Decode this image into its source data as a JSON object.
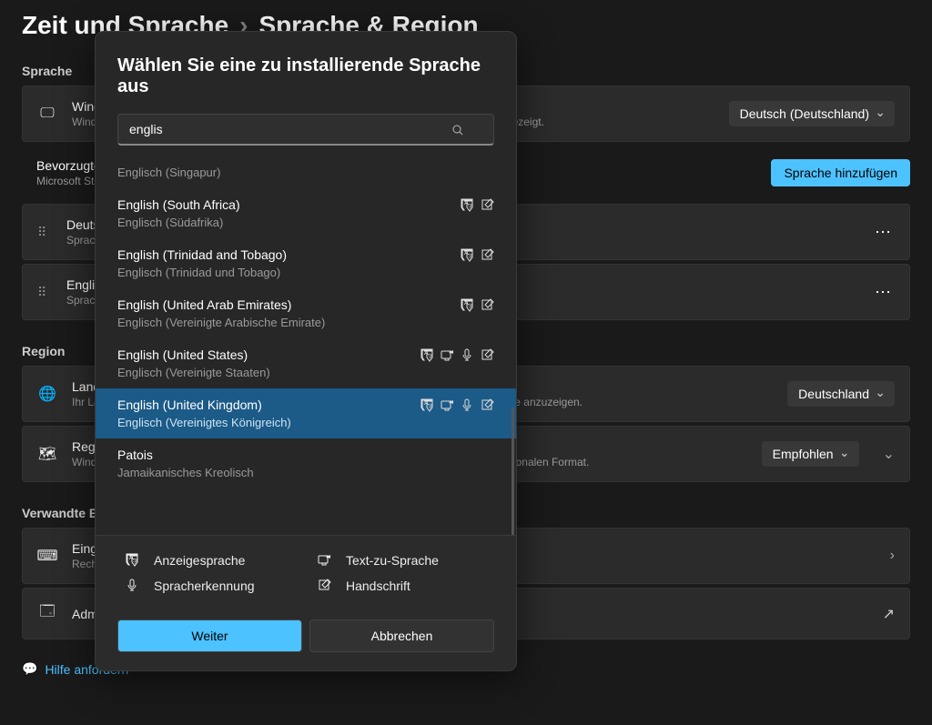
{
  "breadcrumb": {
    "crumb1": "Zeit und Sprache",
    "crumb2": "Sprache & Region"
  },
  "sections": {
    "sprache": "Sprache",
    "region": "Region",
    "verwandte": "Verwandte Einstellungen"
  },
  "cards": {
    "display": {
      "title": "Windows-Anzeigesprache",
      "sub": "Windows-Features wie Einstellungen und der Datei-Explorer werden in dieser Sprache angezeigt.",
      "value": "Deutsch (Deutschland)"
    },
    "preferred": {
      "title": "Bevorzugte Sprachen",
      "sub": "Microsoft Store-Apps werden in der ersten unterstützten Sprache aus dieser Liste angezeigt",
      "button": "Sprache hinzufügen"
    },
    "lang1": {
      "title": "Deutsch (Deutschland)",
      "sub": "Sprachpaket, Text-zu-Sprache, Spracherkennung, Handschrift"
    },
    "lang2": {
      "title": "English (United States)",
      "sub": "Sprachpaket, Text-zu-Sprache, Spracherkennung, Handschrift"
    },
    "country": {
      "title": "Land oder Region",
      "sub": "Ihr Land oder Ihre Region kann von Windows und Apps verwendet werden, um lokale Inhalte anzuzeigen.",
      "value": "Deutschland"
    },
    "format": {
      "title": "Regionales Format",
      "sub": "Windows und einige Apps formatieren Datums- und Uhrzeitangaben basierend auf dem regionalen Format.",
      "value": "Empfohlen"
    },
    "typing": {
      "title": "Eingabe",
      "sub": "Rechtschreibprüfung, Autokorrektur und Textvorschläge"
    },
    "admin": {
      "title": "Administrative Spracheinstellungen"
    }
  },
  "help": "Hilfe anfordern",
  "modal": {
    "title": "Wählen Sie eine zu installierende Sprache aus",
    "search_value": "englis",
    "items": [
      {
        "name": "",
        "sub": "Englisch (Singapur)",
        "icons": [],
        "headerOnly": true
      },
      {
        "name": "English (South Africa)",
        "sub": "Englisch (Südafrika)",
        "icons": [
          "display",
          "hand"
        ]
      },
      {
        "name": "English (Trinidad and Tobago)",
        "sub": "Englisch (Trinidad und Tobago)",
        "icons": [
          "display",
          "hand"
        ]
      },
      {
        "name": "English (United Arab Emirates)",
        "sub": "Englisch (Vereinigte Arabische Emirate)",
        "icons": [
          "display",
          "hand"
        ]
      },
      {
        "name": "English (United States)",
        "sub": "Englisch (Vereinigte Staaten)",
        "icons": [
          "display",
          "tts",
          "mic",
          "hand"
        ]
      },
      {
        "name": "English (United Kingdom)",
        "sub": "Englisch (Vereinigtes Königreich)",
        "icons": [
          "display",
          "tts",
          "mic",
          "hand"
        ],
        "selected": true
      },
      {
        "name": "Patois",
        "sub": "Jamaikanisches Kreolisch",
        "icons": []
      }
    ],
    "legend": {
      "display": "Anzeigesprache",
      "tts": "Text-zu-Sprache",
      "mic": "Spracherkennung",
      "hand": "Handschrift"
    },
    "next": "Weiter",
    "cancel": "Abbrechen"
  }
}
